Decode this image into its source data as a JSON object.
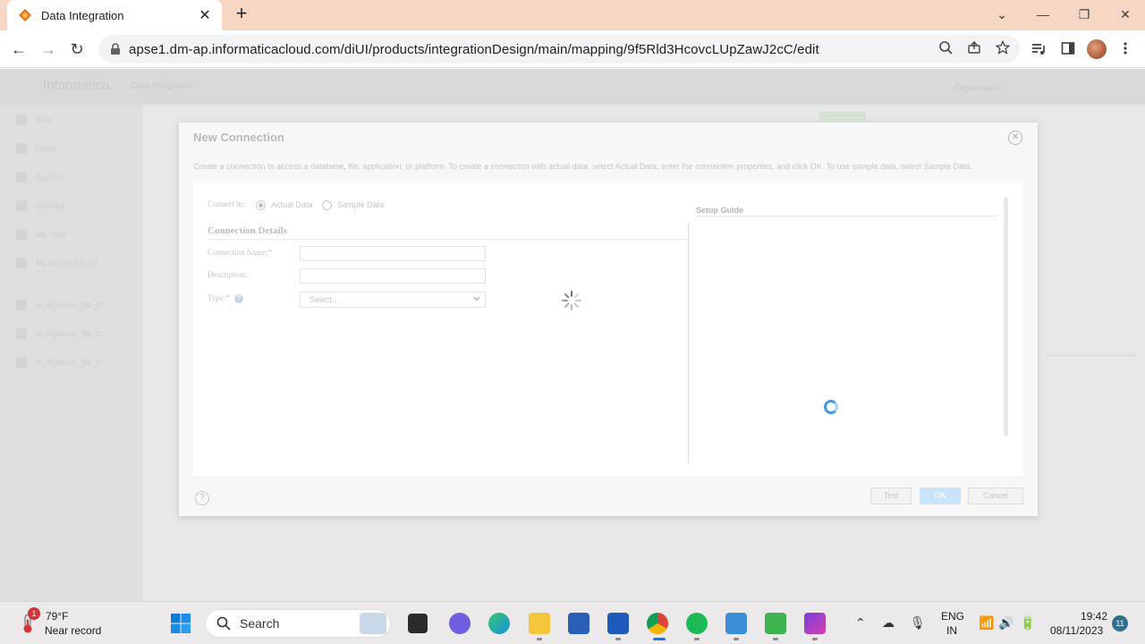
{
  "browser": {
    "tab_title": "Data Integration",
    "tab_close": "✕",
    "new_tab": "+",
    "url": "apse1.dm-ap.informaticacloud.com/diUI/products/integrationDesign/main/mapping/9f5Rld3HcovcLUpZawJ2cC/edit",
    "window_controls": {
      "minimize": "⌄",
      "restore": "—",
      "maximize": "❐",
      "close": "✕"
    },
    "nav": {
      "back": "←",
      "forward": "→",
      "reload": "↻"
    },
    "icons": {
      "zoom": "zoom-icon",
      "share": "share-icon",
      "bookmark": "star-icon",
      "media": "media-icon",
      "sidepanel": "side-panel-icon",
      "menu": "kebab-menu-icon"
    }
  },
  "app": {
    "logo": "Informatica",
    "product": "Data Integration",
    "org": "Organization",
    "sidebar": [
      {
        "label": "New",
        "icon": "plus-icon"
      },
      {
        "label": "Home",
        "icon": "home-icon"
      },
      {
        "label": "Explore",
        "icon": "folder-icon"
      },
      {
        "label": "Bundles",
        "icon": "bundle-icon"
      },
      {
        "label": "My Jobs",
        "icon": "jobs-icon"
      },
      {
        "label": "My Import/Export",
        "icon": "import-export-icon"
      },
      {
        "label": "m_dynamic_file_cr...",
        "icon": "mapping-icon"
      },
      {
        "label": "m_dynamic_file_cr...",
        "icon": "mapping-icon"
      },
      {
        "label": "m_dynamic_file_cr...",
        "icon": "mapping-icon"
      }
    ]
  },
  "modal": {
    "title": "New Connection",
    "description": "Create a connection to access a database, file, application, or platform. To create a connection with actual data, select Actual Data, enter the connection properties, and click OK. To use sample data, select Sample Data.",
    "connect_to_label": "Connect to:",
    "options": [
      {
        "label": "Actual Data",
        "checked": true
      },
      {
        "label": "Sample Data",
        "checked": false
      }
    ],
    "section_title": "Connection Details",
    "fields": {
      "name_label": "Connection Name:*",
      "name_value": "",
      "description_label": "Description:",
      "description_value": "",
      "type_label": "Type:*",
      "type_value": "Select..."
    },
    "setup_guide_title": "Setup Guide",
    "buttons": {
      "test": "Test",
      "ok": "OK",
      "cancel": "Cancel"
    },
    "help": "?",
    "close": "✕"
  },
  "taskbar": {
    "weather": {
      "temp": "79°F",
      "desc": "Near record",
      "badge": "1"
    },
    "search_placeholder": "Search",
    "language_line1": "ENG",
    "language_line2": "IN",
    "time": "19:42",
    "date": "08/11/2023",
    "notifications": "11"
  },
  "colors": {
    "tabstrip": "#f6d7c4",
    "accent": "#3d9be9",
    "ok_button": "#c9e5fb"
  }
}
